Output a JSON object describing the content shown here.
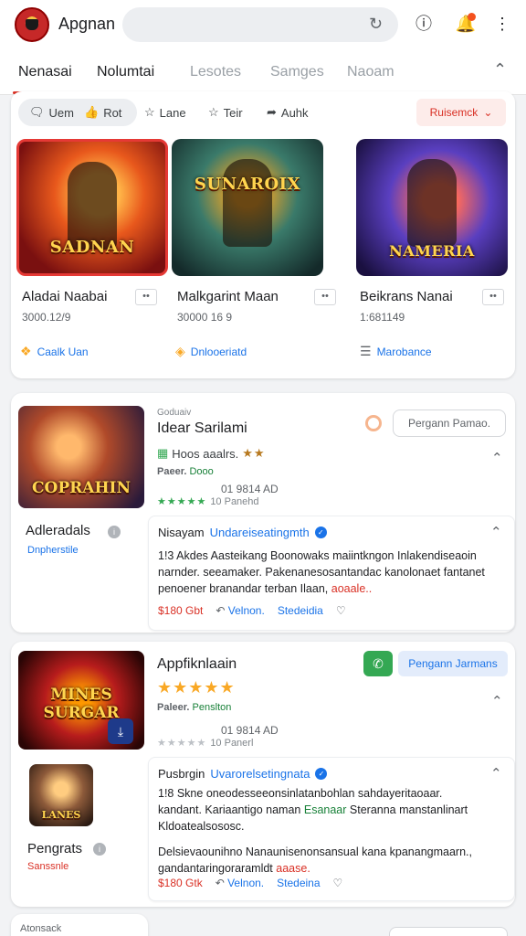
{
  "header": {
    "app_title": "Apgnan",
    "search_icon": "refresh-icon",
    "icons": [
      "info-icon",
      "notification-icon",
      "more-vert-icon"
    ],
    "badge_color": "#f4511e"
  },
  "tabs": {
    "items": [
      "Nenasai",
      "Nolumtai",
      "Lesotes",
      "Samges",
      "Naoam"
    ],
    "active_color": "#d93025"
  },
  "card1": {
    "chips": [
      "Uem",
      "Rot",
      "Lane",
      "Teir",
      "Auhk"
    ],
    "sort_label": "Ruisemck",
    "tiles": [
      {
        "art_text": "SADNAN",
        "name": "Aladai Naabai",
        "meta": "3000.12/9",
        "tag": "Caalk Uan"
      },
      {
        "art_text": "SUNAROIX",
        "name": "Malkgarint Maan",
        "meta": "30000 16 9",
        "tag": "Dnlooeriatd"
      },
      {
        "art_text": "NAMERIA",
        "name": "Beikrans Nanai",
        "meta": "1:681149",
        "tag": "Marobance"
      }
    ]
  },
  "item2": {
    "thumb_text": "COPRAHIN",
    "side_name": "Adleradals",
    "side_sub": "Dnpherstile",
    "small_label": "Goduaiv",
    "title": "Idear Sarilami",
    "rating_text": "Hoos aaalrs.",
    "stars": "★★",
    "publisher_label": "Paeer.",
    "publisher_name": "Dooo",
    "pub_meta": "01 9814 AD",
    "pub_meta2": "10 Panehd",
    "button": "Pergann Pamao.",
    "review": {
      "author": "Nisayam",
      "handle": "Undareiseatingmth",
      "body1": "1!3 Akdes Aasteikang Boonowaks maiintkngon Inlakendiseaoin",
      "body2": "narnder. seeamaker. Pakenanesosantandac kanolonaet fantanet",
      "body3": "penoener branandar terban Ilaan,",
      "body3_link": "aoaale..",
      "price": "$180 Gbt",
      "action1": "Velnon.",
      "action2": "Stedeidia"
    }
  },
  "item3": {
    "thumb_text": "MINES SURGAR",
    "small_thumb_text": "LANES",
    "side_name": "Pengrats",
    "side_sub": "Sanssnle",
    "title": "Appfiknlaain",
    "stars": "★★★★★",
    "publisher_label": "Paleer.",
    "publisher_name": "Penslton",
    "pub_meta": "01 9814 AD",
    "pub_meta2": "10 Panerl",
    "button": "Pengann Jarmans",
    "review": {
      "author": "Pusbrgin",
      "handle": "Uvarorelsetingnata",
      "body1": "1!8 Skne oneodesseeonsinlatanbohlan sahdayeritaoaar.",
      "body2": "kandant. Kariaantigo naman",
      "body2_green": "Esanaar",
      "body2_rest": "Steranna manstanlinart",
      "body3": "Kldoatealsososc.",
      "body4": "Delsievaounihno Nanaunisenonsansual kana kpanangmaarn.,",
      "body5": "gandantaringoraramldt",
      "body5_link": "aaase.",
      "price": "$180 Gtk",
      "action1": "Velnon.",
      "action2": "Stedeina"
    }
  },
  "bottom": {
    "label": "Atonsack"
  }
}
